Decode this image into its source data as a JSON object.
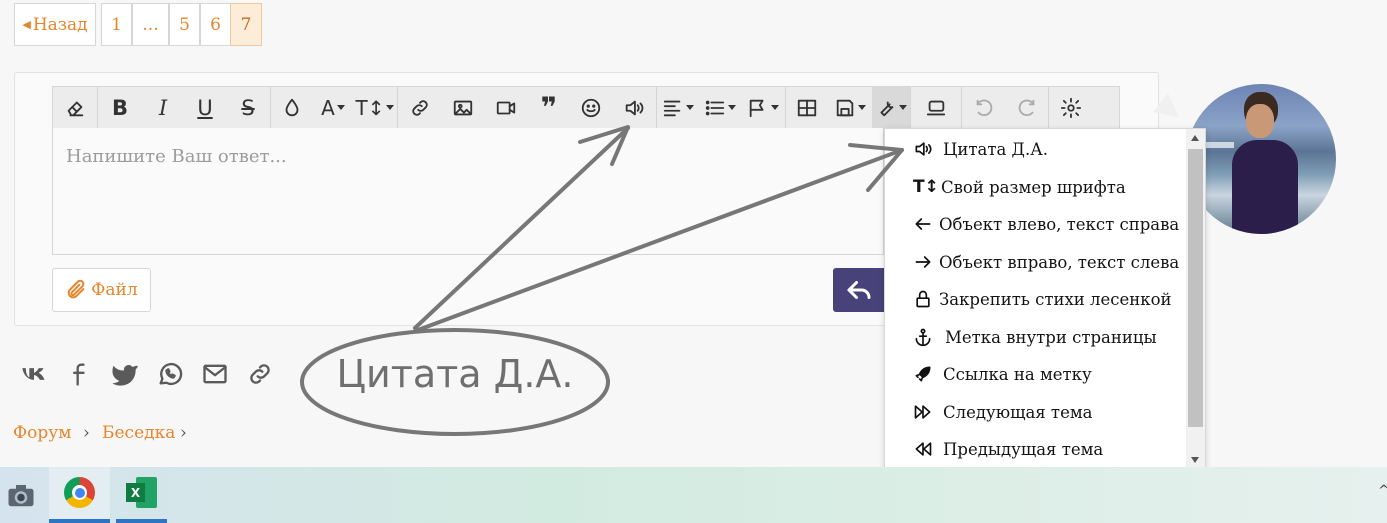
{
  "pager": {
    "back": "Назад",
    "pages": [
      "1",
      "...",
      "5",
      "6",
      "7"
    ],
    "current": "7"
  },
  "toolbar": {
    "buttons": [
      "eraser-icon",
      "bold-icon",
      "italic-icon",
      "underline-icon",
      "strike-icon",
      "color-drop-icon",
      "font-color-icon",
      "font-size-icon",
      "link-icon",
      "image-icon",
      "video-icon",
      "quote-icon",
      "smile-icon",
      "volume-icon",
      "align-icon",
      "list-icon",
      "flag-icon",
      "table-icon",
      "save-icon",
      "wrench-icon",
      "preview-icon",
      "undo-icon",
      "redo-icon",
      "settings-icon"
    ]
  },
  "editor": {
    "placeholder": "Напишите Ваш ответ..."
  },
  "file_button": "Файл",
  "menu": {
    "items": [
      {
        "icon": "volume-icon",
        "label": "Цитата Д.А."
      },
      {
        "icon": "text-size-icon",
        "label": "Свой размер шрифта"
      },
      {
        "icon": "arrow-left-icon",
        "label": "Объект влево, текст справа"
      },
      {
        "icon": "arrow-right-icon",
        "label": "Объект вправо, текст слева"
      },
      {
        "icon": "lock-icon",
        "label": "Закрепить стихи лесенкой"
      },
      {
        "icon": "anchor-icon",
        "label": "Метка внутри страницы"
      },
      {
        "icon": "rocket-icon",
        "label": "Ссылка на метку"
      },
      {
        "icon": "fast-forward-icon",
        "label": "Следующая тема"
      },
      {
        "icon": "fast-backward-icon",
        "label": "Предыдущая тема"
      }
    ]
  },
  "annotation": {
    "text": "Цитата Д.А."
  },
  "share": [
    "vk-icon",
    "facebook-icon",
    "twitter-icon",
    "whatsapp-icon",
    "mail-icon",
    "link-icon"
  ],
  "breadcrumb": {
    "items": [
      "Форум",
      "Беседка"
    ]
  },
  "taskbar": {
    "apps": [
      "camera-icon",
      "chrome-icon",
      "excel-icon"
    ]
  },
  "colors": {
    "accent": "#e8852b",
    "send": "#47427a"
  }
}
